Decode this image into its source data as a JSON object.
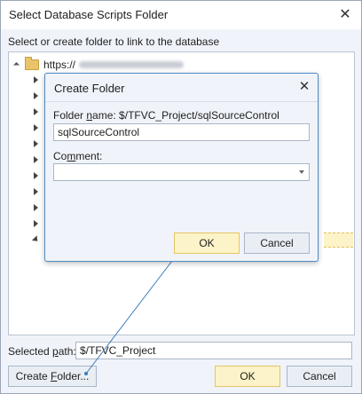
{
  "window": {
    "title": "Select Database Scripts Folder",
    "close_symbol": "✕"
  },
  "instruction": "Select or create folder to link to the database",
  "tree": {
    "root_label": "https://"
  },
  "selected_path": {
    "label_pre": "Selected ",
    "label_accel": "p",
    "label_post": "ath:",
    "value": "$/TFVC_Project"
  },
  "buttons": {
    "create_folder_pre": "Create ",
    "create_folder_accel": "F",
    "create_folder_post": "older...",
    "ok": "OK",
    "cancel": "Cancel"
  },
  "dialog": {
    "title": "Create Folder",
    "close_symbol": "✕",
    "folder_label_pre": "Folder ",
    "folder_label_accel": "n",
    "folder_label_post": "ame: $/TFVC_Project/sqlSourceControl",
    "folder_value": "sqlSourceControl",
    "comment_label_pre": "Co",
    "comment_label_accel": "m",
    "comment_label_post": "ment:",
    "comment_value": "",
    "ok": "OK",
    "cancel": "Cancel"
  },
  "colors": {
    "accent_border": "#4d8bc4",
    "primary_button": "#fdf3c8",
    "link_line": "#3c7dbc"
  }
}
